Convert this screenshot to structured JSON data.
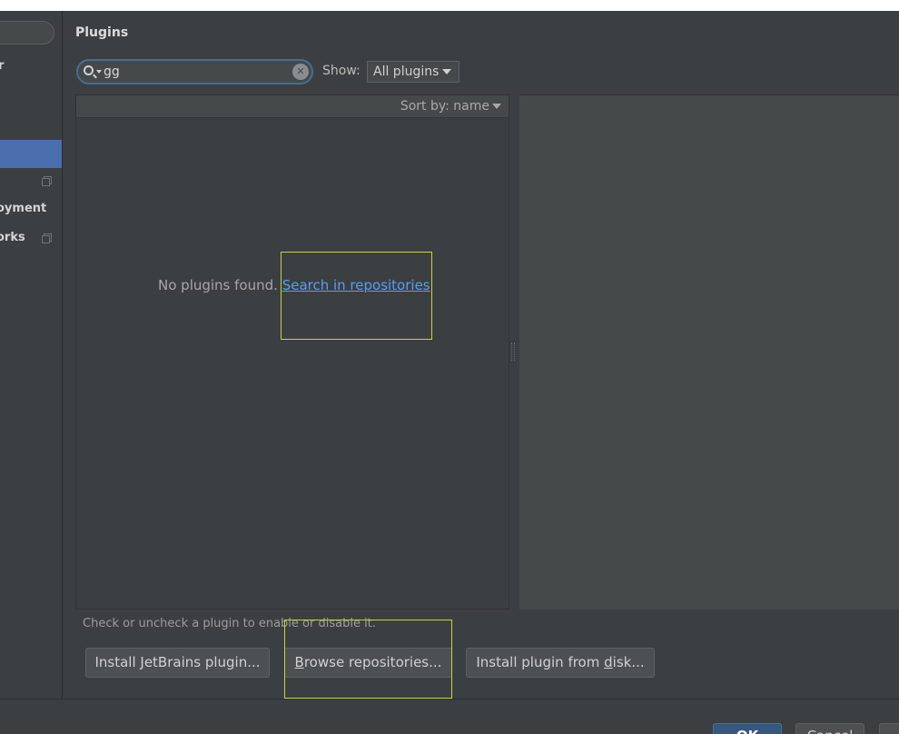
{
  "sidebar": {
    "items": [
      {
        "label": "r"
      },
      {
        "label": "oyment"
      },
      {
        "label": "orks"
      }
    ]
  },
  "plugins": {
    "title": "Plugins",
    "search_value": "gg",
    "show_label": "Show:",
    "show_select_value": "All plugins",
    "sort_label": "Sort by: name",
    "empty_message": "No plugins found.",
    "search_link": "Search in repositories",
    "hint": "Check or uncheck a plugin to enable or disable it.",
    "buttons": {
      "install_jetbrains": {
        "before": "Install ",
        "mnemonic": "J",
        "after": "etBrains plugin..."
      },
      "browse": {
        "before": "",
        "mnemonic": "B",
        "after": "rowse repositories..."
      },
      "install_disk": {
        "before": "Install plugin from ",
        "mnemonic": "d",
        "after": "isk..."
      }
    }
  },
  "dialog": {
    "ok_label": "OK",
    "cancel_label": "Cancel"
  },
  "colors": {
    "selection": "#4b6eaf",
    "link": "#589df6",
    "annotation": "#c8d43c",
    "ok_button": "#365880"
  }
}
